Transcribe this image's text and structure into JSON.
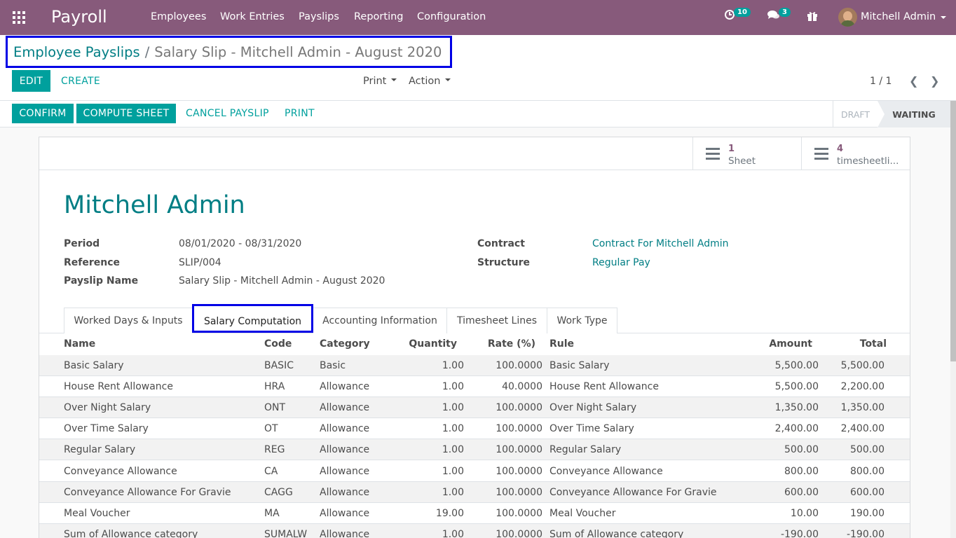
{
  "navbar": {
    "brand": "Payroll",
    "menu": [
      "Employees",
      "Work Entries",
      "Payslips",
      "Reporting",
      "Configuration"
    ],
    "activity_count": "10",
    "messages_count": "3",
    "user_name": "Mitchell Admin"
  },
  "breadcrumb": {
    "parent": "Employee Payslips",
    "separator": "/",
    "current": "Salary Slip - Mitchell Admin - August 2020"
  },
  "control": {
    "edit_label": "EDIT",
    "create_label": "CREATE",
    "print_label": "Print",
    "action_label": "Action",
    "pager": "1 / 1"
  },
  "statusbar": {
    "confirm_label": "CONFIRM",
    "compute_label": "COMPUTE SHEET",
    "cancel_label": "CANCEL PAYSLIP",
    "print_label": "PRINT",
    "states": [
      "DRAFT",
      "WAITING"
    ]
  },
  "smart_buttons": [
    {
      "value": "1",
      "label": "Sheet"
    },
    {
      "value": "4",
      "label": "timesheetli..."
    }
  ],
  "employee": {
    "name": "Mitchell Admin",
    "period_label": "Period",
    "period": "08/01/2020 - 08/31/2020",
    "reference_label": "Reference",
    "reference": "SLIP/004",
    "payslip_name_label": "Payslip Name",
    "payslip_name": "Salary Slip - Mitchell Admin - August 2020",
    "contract_label": "Contract",
    "contract": "Contract For Mitchell Admin",
    "structure_label": "Structure",
    "structure": "Regular Pay"
  },
  "tabs": [
    "Worked Days & Inputs",
    "Salary Computation",
    "Accounting Information",
    "Timesheet Lines",
    "Work Type"
  ],
  "table": {
    "headers": [
      "Name",
      "Code",
      "Category",
      "Quantity",
      "Rate (%)",
      "Rule",
      "Amount",
      "Total"
    ],
    "rows": [
      [
        "Basic Salary",
        "BASIC",
        "Basic",
        "1.00",
        "100.0000",
        "Basic Salary",
        "5,500.00",
        "5,500.00"
      ],
      [
        "House Rent Allowance",
        "HRA",
        "Allowance",
        "1.00",
        "40.0000",
        "House Rent Allowance",
        "5,500.00",
        "2,200.00"
      ],
      [
        "Over Night Salary",
        "ONT",
        "Allowance",
        "1.00",
        "100.0000",
        "Over Night Salary",
        "1,350.00",
        "1,350.00"
      ],
      [
        "Over Time Salary",
        "OT",
        "Allowance",
        "1.00",
        "100.0000",
        "Over Time Salary",
        "2,400.00",
        "2,400.00"
      ],
      [
        "Regular Salary",
        "REG",
        "Allowance",
        "1.00",
        "100.0000",
        "Regular Salary",
        "500.00",
        "500.00"
      ],
      [
        "Conveyance Allowance",
        "CA",
        "Allowance",
        "1.00",
        "100.0000",
        "Conveyance Allowance",
        "800.00",
        "800.00"
      ],
      [
        "Conveyance Allowance For Gravie",
        "CAGG",
        "Allowance",
        "1.00",
        "100.0000",
        "Conveyance Allowance For Gravie",
        "600.00",
        "600.00"
      ],
      [
        "Meal Voucher",
        "MA",
        "Allowance",
        "19.00",
        "100.0000",
        "Meal Voucher",
        "10.00",
        "190.00"
      ],
      [
        "Sum of Allowance category",
        "SUMALW",
        "Allowance",
        "1.00",
        "100.0000",
        "Sum of Allowance category",
        "-190.00",
        "-190.00"
      ]
    ]
  },
  "colors": {
    "brand": "#875a7b",
    "primary": "#00a09d",
    "link": "#017e84",
    "highlight_box": "#0000e6"
  }
}
